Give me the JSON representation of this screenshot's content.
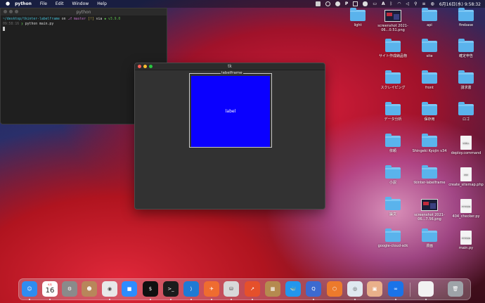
{
  "menubar": {
    "apple": "",
    "app": "python",
    "items": [
      "File",
      "Edit",
      "Window",
      "Help"
    ],
    "clock": "6月16日(水) 9:58:32"
  },
  "terminal": {
    "title": "python",
    "line1_path": "~/desktop/tkinter-labelframe",
    "line1_on": "on",
    "line1_branch": "master",
    "line1_flag": "[!]",
    "line1_via": "via",
    "line1_ver": "v3.9.0",
    "line2_time": "09:58:16",
    "line2_cmd": "python main.py"
  },
  "tk": {
    "title": "tk",
    "labelframe_text": "labelframe",
    "label_text": "label",
    "label_bg": "#0a00ff"
  },
  "desktop": {
    "icons": [
      {
        "label": "light",
        "kind": "folder"
      },
      {
        "label": "screenshot 2021-06…0.51.png",
        "kind": "shot"
      },
      {
        "label": "api",
        "kind": "folder"
      },
      {
        "label": "firebase",
        "kind": "folder"
      },
      {
        "label": "サイト作成納品物",
        "kind": "folder"
      },
      {
        "label": "site",
        "kind": "folder"
      },
      {
        "label": "確定申告",
        "kind": "folder"
      },
      {
        "label": "スクレイピング",
        "kind": "folder"
      },
      {
        "label": "front",
        "kind": "folder"
      },
      {
        "label": "請求書",
        "kind": "folder"
      },
      {
        "label": "データ分析",
        "kind": "folder"
      },
      {
        "label": "保存用",
        "kind": "folder"
      },
      {
        "label": "ロゴ",
        "kind": "folder"
      },
      {
        "label": "依頼",
        "kind": "folder"
      },
      {
        "label": "Shingeki Kyojin v34",
        "kind": "folder"
      },
      {
        "label": "deploy.command",
        "kind": "doc",
        "doc_tag": "SHELL"
      },
      {
        "label": "小説",
        "kind": "folder"
      },
      {
        "label": "tkinter-labelframe",
        "kind": "folder"
      },
      {
        "label": "create_sitemap.php",
        "kind": "doc",
        "doc_tag": "PHP"
      },
      {
        "label": "論文",
        "kind": "folder"
      },
      {
        "label": "screenshot 2021-06…7.56.png",
        "kind": "shot"
      },
      {
        "label": "404_checker.py",
        "kind": "doc",
        "doc_tag": "PYTHON"
      },
      {
        "label": "google-cloud-sdk",
        "kind": "folder"
      },
      {
        "label": "漫画",
        "kind": "folder"
      },
      {
        "label": "main.py",
        "kind": "doc",
        "doc_tag": "PYTHON"
      }
    ]
  },
  "dock": {
    "calendar_month": "6月",
    "calendar_day": "16",
    "items": [
      {
        "name": "finder",
        "color": "#2f8cf0",
        "glyph": "☺"
      },
      {
        "name": "calendar",
        "color": "#ffffff",
        "glyph": ""
      },
      {
        "name": "system-preferences",
        "color": "#8a8a8a",
        "glyph": "⚙"
      },
      {
        "name": "contacts",
        "color": "#b8865a",
        "glyph": "☻"
      },
      {
        "name": "chrome",
        "color": "#e8e8e8",
        "glyph": "◉"
      },
      {
        "name": "zoom",
        "color": "#2d8cff",
        "glyph": "■"
      },
      {
        "name": "iterm",
        "color": "#101010",
        "glyph": "$"
      },
      {
        "name": "terminal",
        "color": "#1c1c1c",
        "glyph": ">_"
      },
      {
        "name": "vscode",
        "color": "#1f7ad4",
        "glyph": "⟩"
      },
      {
        "name": "postman",
        "color": "#ef6c30",
        "glyph": "✈"
      },
      {
        "name": "sequel-pro",
        "color": "#d8d8d8",
        "glyph": "⛁"
      },
      {
        "name": "analytics",
        "color": "#e5502b",
        "glyph": "↗"
      },
      {
        "name": "archive",
        "color": "#b58a4f",
        "glyph": "▦"
      },
      {
        "name": "docker",
        "color": "#2396ed",
        "glyph": "🐳"
      },
      {
        "name": "quicktime",
        "color": "#3c6ad0",
        "glyph": "Q"
      },
      {
        "name": "sourcetree",
        "color": "#ec7a2c",
        "glyph": "⬡"
      },
      {
        "name": "disk-utility",
        "color": "#dfe8f0",
        "glyph": "◎"
      },
      {
        "name": "preview",
        "color": "#e9b08a",
        "glyph": "▣"
      },
      {
        "name": "infinity",
        "color": "#1a73e8",
        "glyph": "∞"
      },
      {
        "name": "document",
        "color": "#f2f2f2",
        "glyph": ""
      },
      {
        "name": "trash",
        "color": "#9ea3a8",
        "glyph": "🗑"
      }
    ]
  }
}
